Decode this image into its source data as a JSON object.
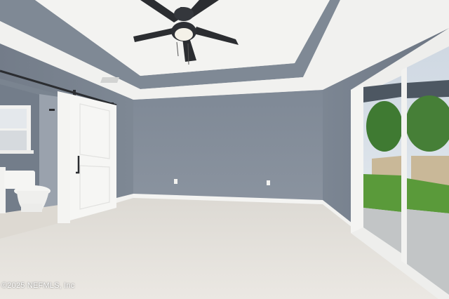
{
  "photo": {
    "watermark": "©2025 NEFMLS, Inc"
  },
  "colors": {
    "wall": "#838d9a",
    "wall_dark": "#6f7885",
    "ceiling": "#f1f1ef",
    "carpet": "#e6e2dc",
    "trim": "#f4f4f2",
    "fan": "#2b2d31",
    "lawn": "#5a9a3a"
  }
}
